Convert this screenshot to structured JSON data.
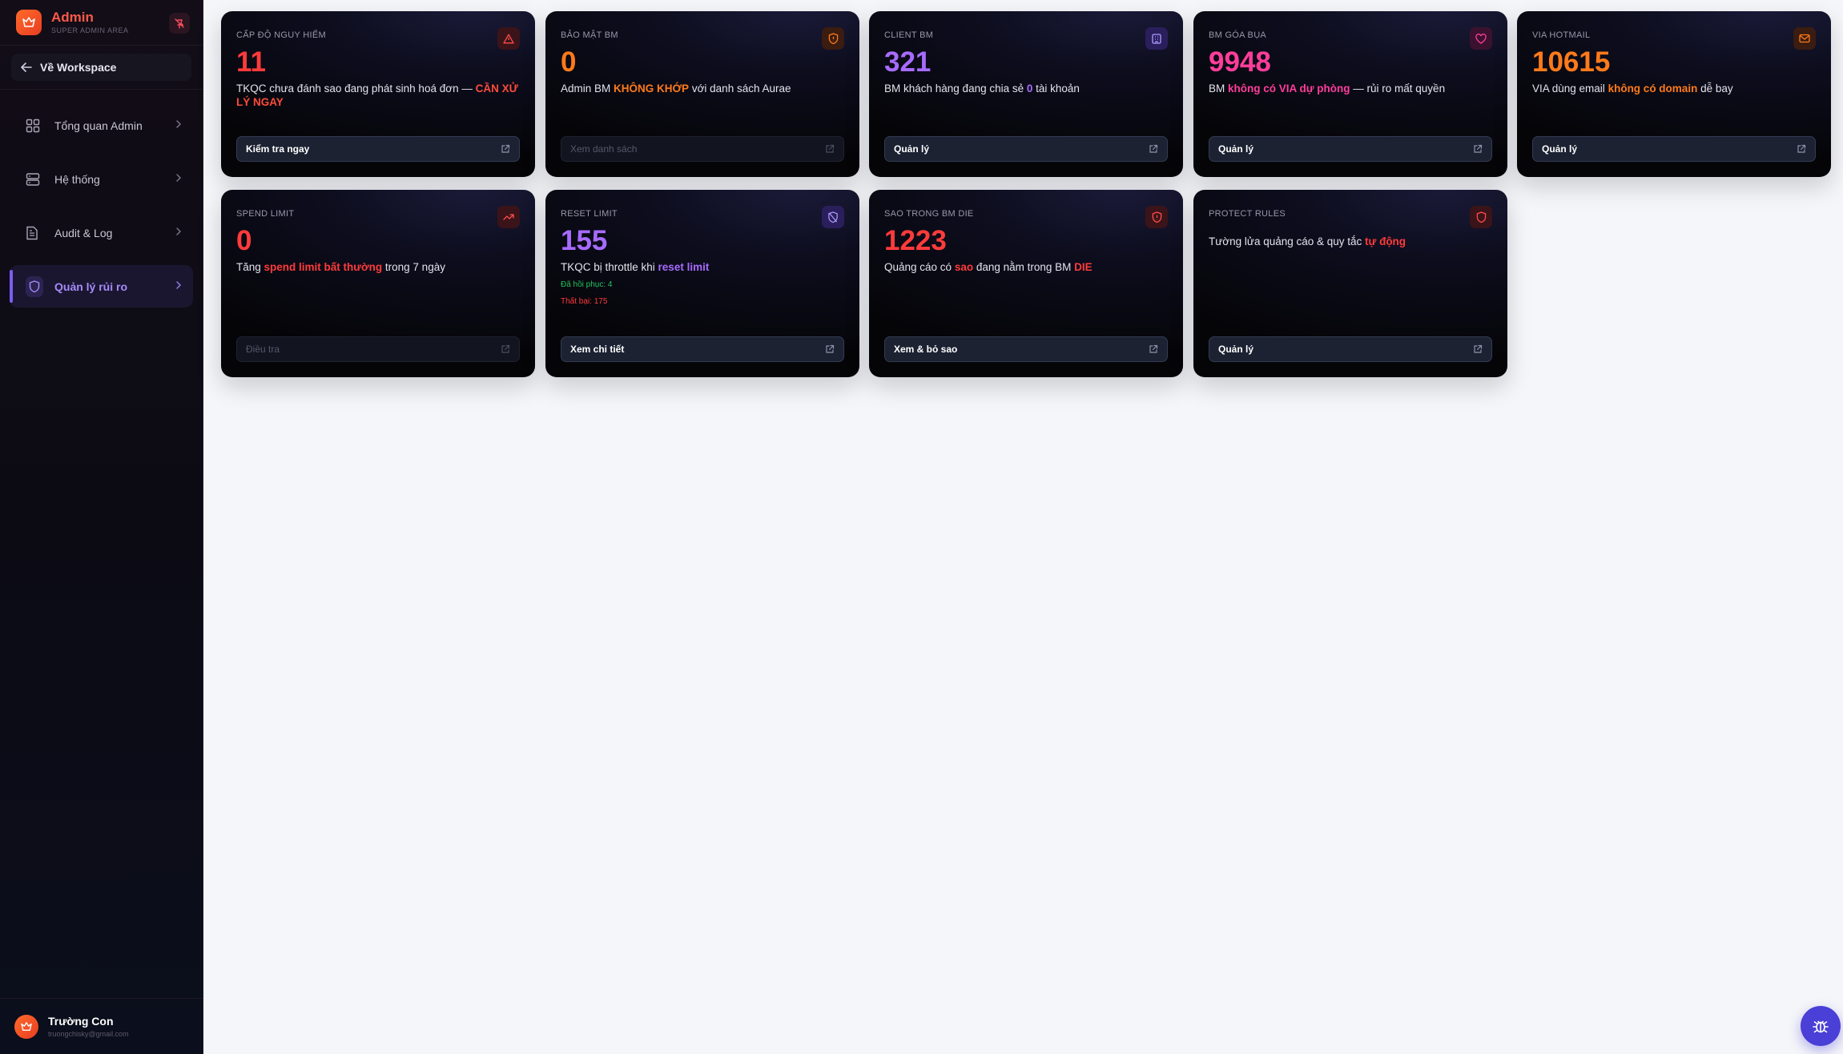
{
  "app": {
    "title": "Admin",
    "subtitle": "SUPER ADMIN AREA",
    "back_label": "Về Workspace"
  },
  "sidebar": {
    "items": [
      {
        "label": "Tổng quan Admin",
        "icon": "dashboard-icon"
      },
      {
        "label": "Hệ thống",
        "icon": "server-icon"
      },
      {
        "label": "Audit & Log",
        "icon": "document-icon"
      },
      {
        "label": "Quản lý rủi ro",
        "icon": "shield-icon",
        "active": true
      }
    ]
  },
  "user": {
    "name": "Trường Con",
    "email": "truongchisky@gmail.com"
  },
  "colors": {
    "red": "#ff3b3b",
    "orange": "#ff7a1a",
    "purple": "#a76bff",
    "pink": "#ff3d9a",
    "green": "#22c55e",
    "accent": "#7c5cf5"
  },
  "cards": [
    {
      "label": "CẤP ĐỘ NGUY HIỂM",
      "value": "11",
      "icon": "warning-triangle-icon",
      "desc_pre": "TKQC chưa đánh sao đang phát sinh hoá đơn — ",
      "desc_hl": "CẦN XỬ LÝ NGAY",
      "desc_post": "",
      "button": "Kiểm tra ngay"
    },
    {
      "label": "BẢO MẬT BM",
      "value": "0",
      "icon": "shield-alert-icon",
      "desc_pre": "Admin BM ",
      "desc_hl": "KHÔNG KHỚP",
      "desc_post": " với danh sách Aurae",
      "button": "Xem danh sách"
    },
    {
      "label": "CLIENT BM",
      "value": "321",
      "icon": "building-icon",
      "desc_pre": "BM khách hàng đang chia sẻ ",
      "desc_hl": "0",
      "desc_post": " tài khoản",
      "button": "Quản lý"
    },
    {
      "label": "BM GÓA BỤA",
      "value": "9948",
      "icon": "heart-icon",
      "desc_pre": "BM ",
      "desc_hl": "không có VIA dự phòng",
      "desc_post": " — rủi ro mất quyền",
      "button": "Quản lý"
    },
    {
      "label": "VIA HOTMAIL",
      "value": "10615",
      "icon": "mail-icon",
      "desc_pre": "VIA dùng email ",
      "desc_hl": "không có domain",
      "desc_post": " dễ bay",
      "button": "Quản lý"
    },
    {
      "label": "SPEND LIMIT",
      "value": "0",
      "icon": "trending-up-icon",
      "desc_pre": "Tăng ",
      "desc_hl": "spend limit bất thường",
      "desc_post": " trong 7 ngày",
      "button": "Điều tra"
    },
    {
      "label": "RESET LIMIT",
      "value": "155",
      "icon": "shield-off-icon",
      "desc_pre": "TKQC bị throttle khi ",
      "desc_hl": "reset limit",
      "desc_post": "",
      "stat_ok": "Đã hồi phục: 4",
      "stat_fail": "Thất bại: 175",
      "button": "Xem chi tiết"
    },
    {
      "label": "SAO TRONG BM DIE",
      "value": "1223",
      "icon": "shield-alert-icon",
      "desc_pre": "Quảng cáo có ",
      "desc_hl": "sao",
      "desc_mid": " đang nằm trong BM ",
      "desc_hl2": "DIE",
      "button": "Xem & bỏ sao"
    },
    {
      "label": "PROTECT RULES",
      "value": "",
      "icon": "shield-icon",
      "desc_pre": "Tường lửa quảng cáo & quy tắc ",
      "desc_hl": "tự động",
      "desc_post": "",
      "button": "Quản lý"
    }
  ]
}
